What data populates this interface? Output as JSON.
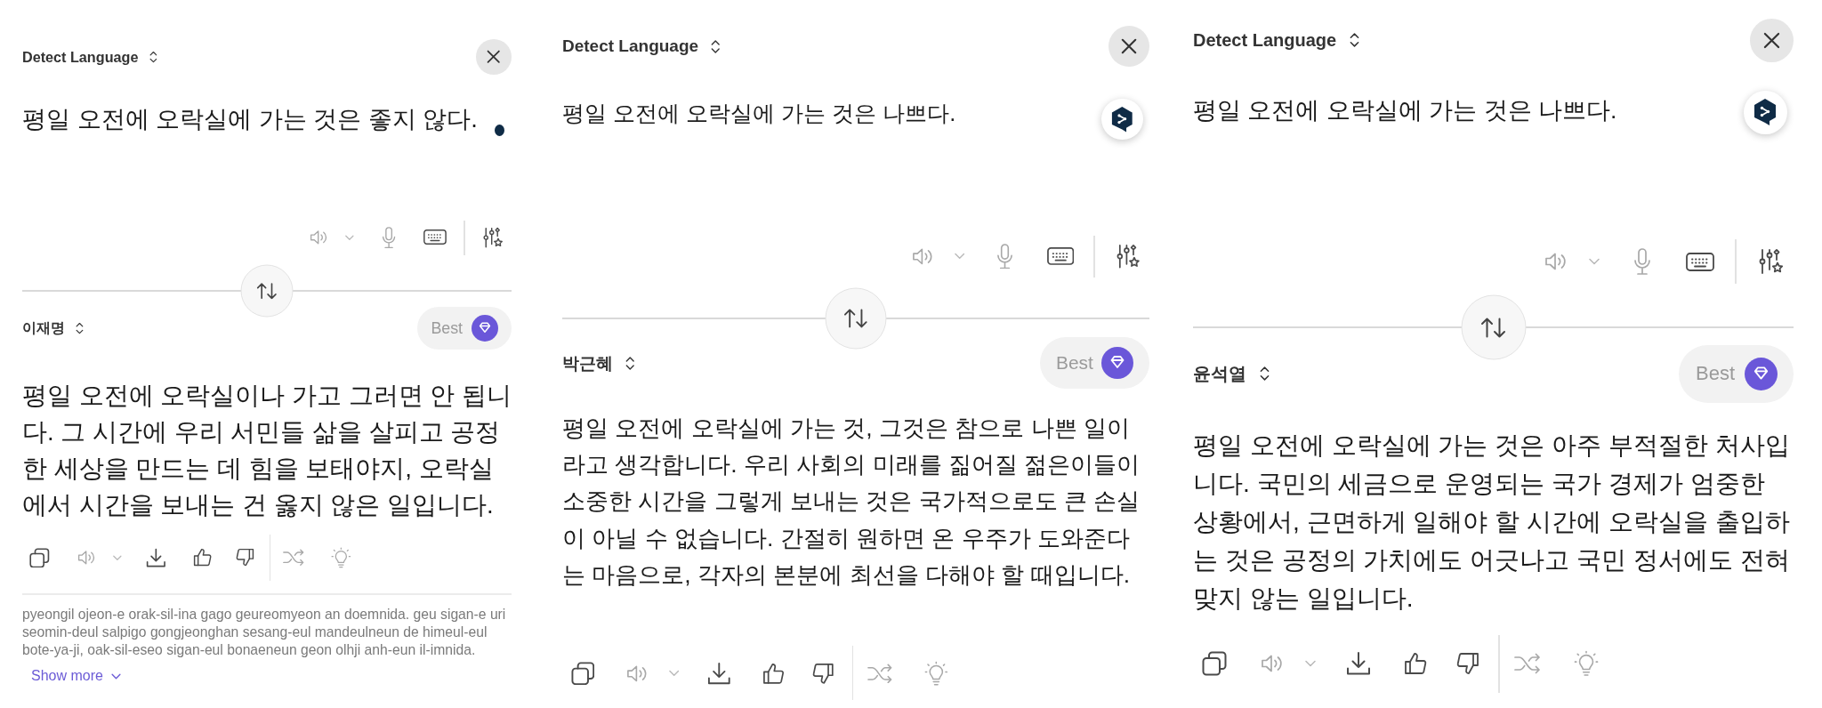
{
  "panels": [
    {
      "source_language": "Detect Language",
      "source_text": "평일 오전에 오락실에 가는 것은 좋지 않다.",
      "cursor_dot": true,
      "input_tools": [
        {
          "disabled": true
        },
        {
          "disabled": true
        },
        {
          "disabled": false
        },
        {
          "disabled": false
        }
      ],
      "target_language": "이재명",
      "quality": "Best",
      "translation": "평일 오전에 오락실이나 가고 그러면 안 됩니다. 그 시간에 우리 서민들 삶을 살피고 공정한 세상을 만드는 데 힘을 보태야지, 오락실에서 시간을 보내는 건 옳지 않은 일입니다.",
      "output_actions": [
        {
          "disabled": false
        },
        {
          "disabled": true
        },
        {
          "disabled": false
        },
        {
          "disabled": false
        },
        {
          "disabled": false
        },
        {
          "disabled": true
        },
        {
          "disabled": true
        }
      ],
      "transliteration": "pyeongil ojeon-e orak-sil-ina gago geureomyeon an doemnida. geu sigan-e uri seomin-deul salpigo gongjeonghan sesang-eul mandeulneun de himeul-eul bote-ya-ji, oak-sil-eseo sigan-eul bonaeneun geon olhji anh-eun il-imnida.",
      "show_more": "Show more"
    },
    {
      "source_language": "Detect Language",
      "source_text": "평일 오전에 오락실에 가는 것은 나쁘다.",
      "logo_button": true,
      "input_tools": [
        {
          "disabled": true
        },
        {
          "disabled": true
        },
        {
          "disabled": false
        },
        {
          "disabled": false
        }
      ],
      "target_language": "박근혜",
      "quality": "Best",
      "translation": "평일 오전에 오락실에 가는 것, 그것은 참으로 나쁜 일이라고 생각합니다. 우리 사회의 미래를 짊어질 젊은이들이 소중한 시간을 그렇게 보내는 것은 국가적으로도 큰 손실이 아닐 수 없습니다. 간절히 원하면 온 우주가 도와준다는 마음으로, 각자의 본분에 최선을 다해야 할 때입니다.",
      "output_actions": [
        {
          "disabled": false
        },
        {
          "disabled": true
        },
        {
          "disabled": false
        },
        {
          "disabled": false
        },
        {
          "disabled": false
        },
        {
          "disabled": true
        },
        {
          "disabled": true
        }
      ]
    },
    {
      "source_language": "Detect Language",
      "source_text": "평일 오전에 오락실에 가는 것은 나쁘다.",
      "logo_button": true,
      "input_tools": [
        {
          "disabled": true
        },
        {
          "disabled": true
        },
        {
          "disabled": false
        },
        {
          "disabled": false
        }
      ],
      "target_language": "윤석열",
      "quality": "Best",
      "translation": "평일 오전에 오락실에 가는 것은 아주 부적절한 처사입니다. 국민의 세금으로 운영되는 국가 경제가 엄중한 상황에서, 근면하게 일해야 할 시간에 오락실을 출입하는 것은 공정의 가치에도 어긋나고 국민 정서에도 전혀 맞지 않는 일입니다.",
      "output_actions": [
        {
          "disabled": false
        },
        {
          "disabled": true
        },
        {
          "disabled": false
        },
        {
          "disabled": false
        },
        {
          "disabled": false
        },
        {
          "disabled": true
        },
        {
          "disabled": true
        }
      ]
    }
  ]
}
